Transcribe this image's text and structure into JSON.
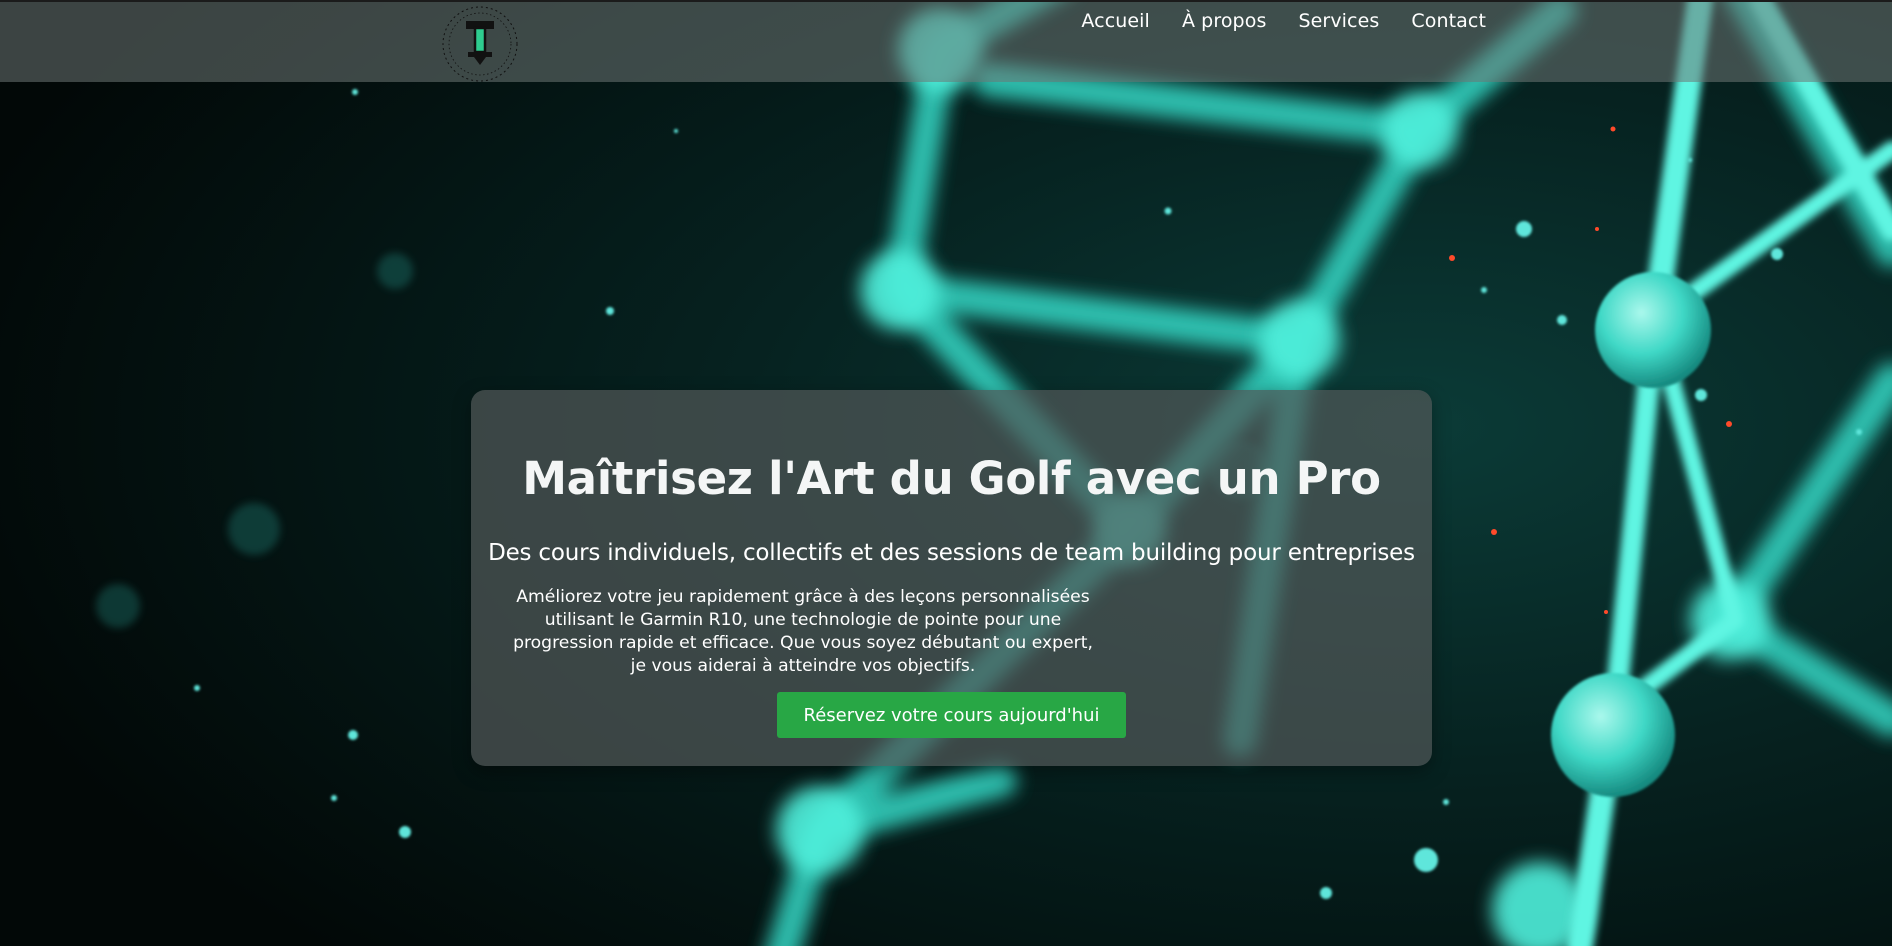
{
  "nav": {
    "items": [
      {
        "label": "Accueil"
      },
      {
        "label": "À propos"
      },
      {
        "label": "Services"
      },
      {
        "label": "Contact"
      }
    ]
  },
  "logo": {
    "letter": "T",
    "ring_text": "THOMAS · GOLF · TEACHING PRO · GOLF ·"
  },
  "hero": {
    "title": "Maîtrisez l'Art du Golf avec un Pro",
    "subtitle": "Des cours individuels, collectifs et des sessions de team building pour entreprises",
    "paragraph_lines": [
      "Améliorez votre jeu rapidement grâce à des leçons personnalisées",
      "utilisant le Garmin R10, une technologie de pointe pour une",
      "progression rapide et efficace. Que vous soyez débutant ou expert,",
      "je vous aiderai à atteindre vos objectifs."
    ],
    "cta_label": "Réservez votre cours aujourd'hui"
  },
  "colors": {
    "accent_green": "#28a745",
    "glow_cyan": "#3fe6d2",
    "background": "#03100f",
    "logo_green": "#2ecc8f"
  },
  "icons": {
    "logo": "golf-tee-logo-icon"
  }
}
